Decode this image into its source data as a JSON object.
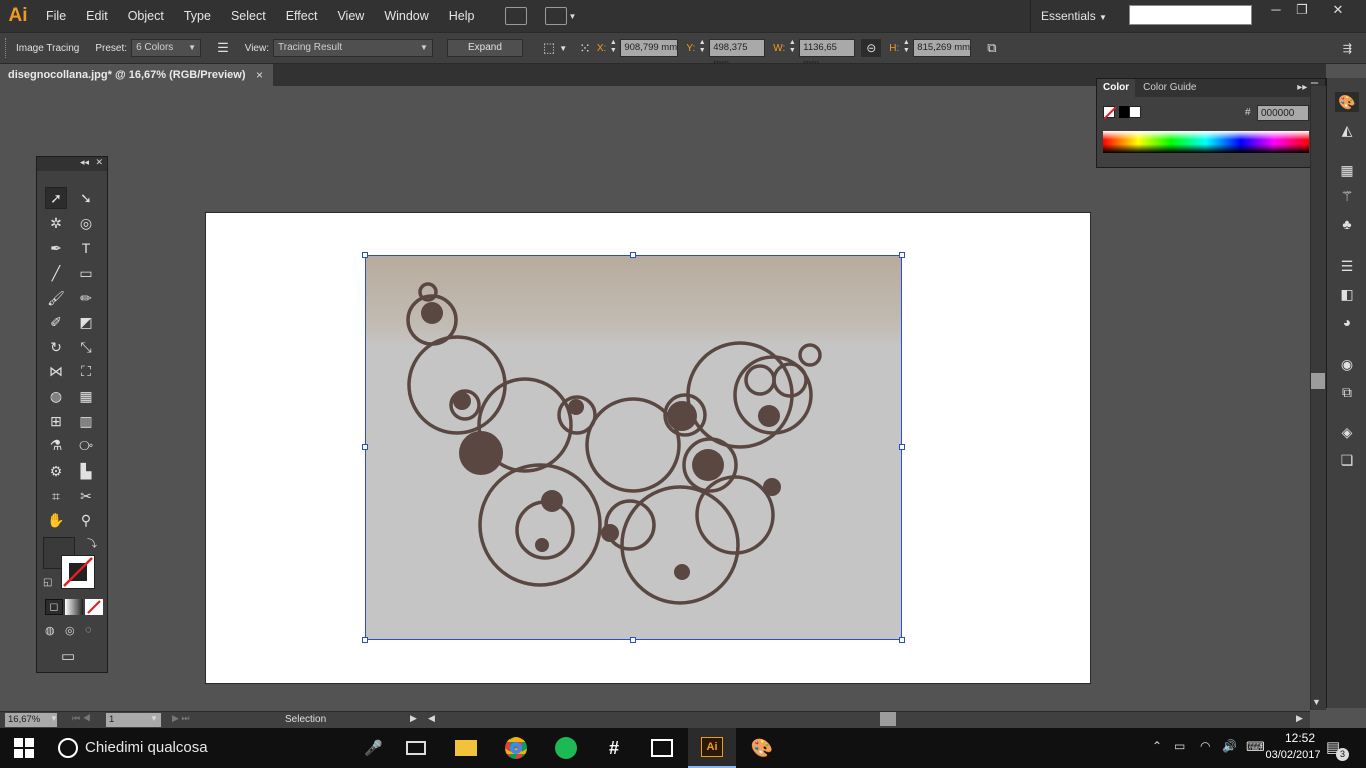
{
  "app": {
    "logo": "Ai"
  },
  "menu": [
    "File",
    "Edit",
    "Object",
    "Type",
    "Select",
    "Effect",
    "View",
    "Window",
    "Help"
  ],
  "workspace": "Essentials",
  "window_controls": {
    "minimize": "─",
    "restore": "❐",
    "close": "✕"
  },
  "control_bar": {
    "mode_label": "Image Tracing",
    "preset_label": "Preset:",
    "preset_value": "6 Colors",
    "view_label": "View:",
    "view_value": "Tracing Result",
    "expand_label": "Expand",
    "x_label": "X:",
    "x_value": "908,799 mm",
    "y_label": "Y:",
    "y_value": "498,375 mm",
    "w_label": "W:",
    "w_value": "1136,65 mm",
    "h_label": "H:",
    "h_value": "815,269 mm"
  },
  "document_tab": {
    "title": "disegnocollana.jpg* @ 16,67% (RGB/Preview)",
    "close": "×"
  },
  "color_panel": {
    "tab_color": "Color",
    "tab_guide": "Color Guide",
    "hex_label": "#",
    "hex_value": "000000"
  },
  "status_bar": {
    "zoom": "16,67%",
    "page": "1",
    "tool_status": "Selection"
  },
  "taskbar": {
    "search_placeholder": "Chiedimi qualcosa",
    "time": "12:52",
    "date": "03/02/2017",
    "notifications": "3"
  },
  "colors": {
    "accent": "#f29a1f",
    "selection": "#2a4fc9",
    "sketch": "#5a4741"
  }
}
